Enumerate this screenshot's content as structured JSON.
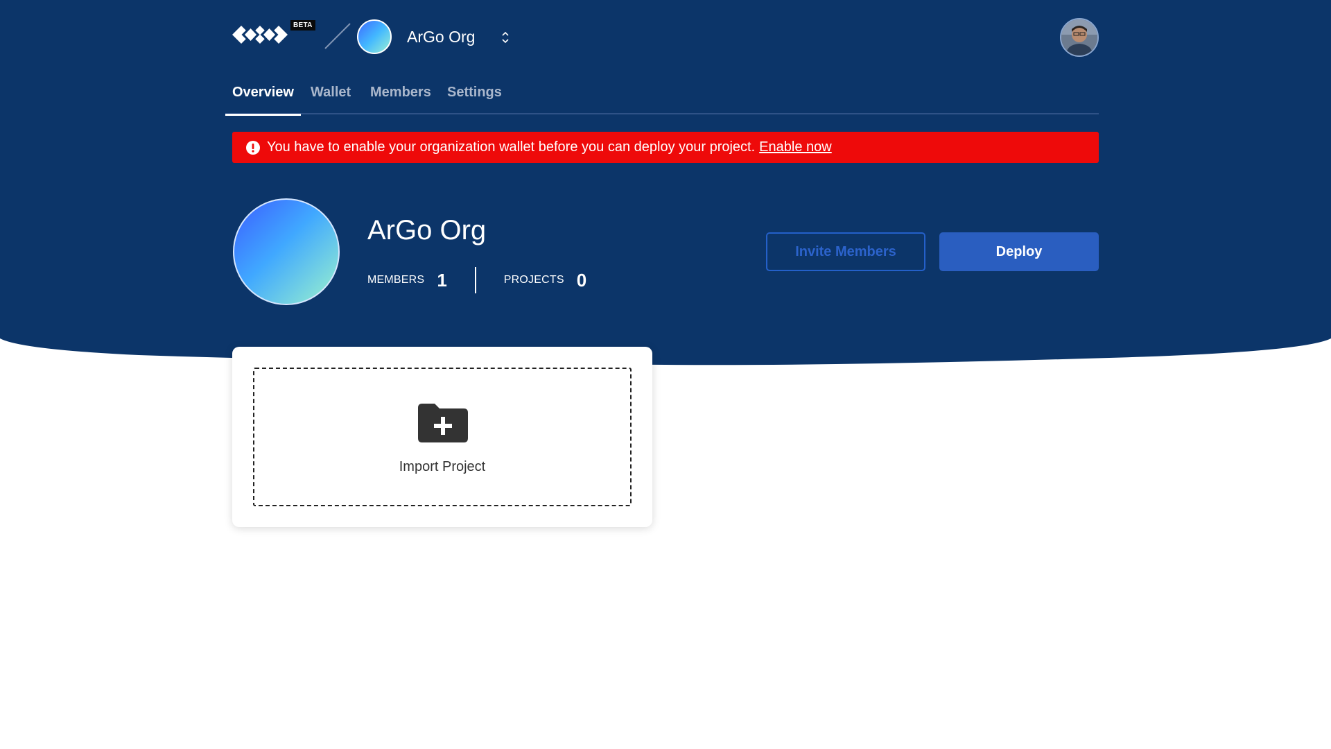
{
  "header": {
    "beta_badge": "BETA",
    "org_switcher_name": "ArGo Org"
  },
  "tabs": [
    {
      "label": "Overview",
      "active": true
    },
    {
      "label": "Wallet",
      "active": false
    },
    {
      "label": "Members",
      "active": false
    },
    {
      "label": "Settings",
      "active": false
    }
  ],
  "alert": {
    "message": "You have to enable your organization wallet before you can deploy your project.",
    "link": "Enable now",
    "color": "#ee0a0a"
  },
  "org": {
    "name": "ArGo Org",
    "members_label": "MEMBERS",
    "members_count": "1",
    "projects_label": "PROJECTS",
    "projects_count": "0"
  },
  "actions": {
    "invite_label": "Invite Members",
    "deploy_label": "Deploy"
  },
  "import": {
    "label": "Import Project",
    "icon": "folder-plus-icon"
  },
  "colors": {
    "hero_bg": "#0c3569",
    "accent": "#2a5ec0"
  }
}
